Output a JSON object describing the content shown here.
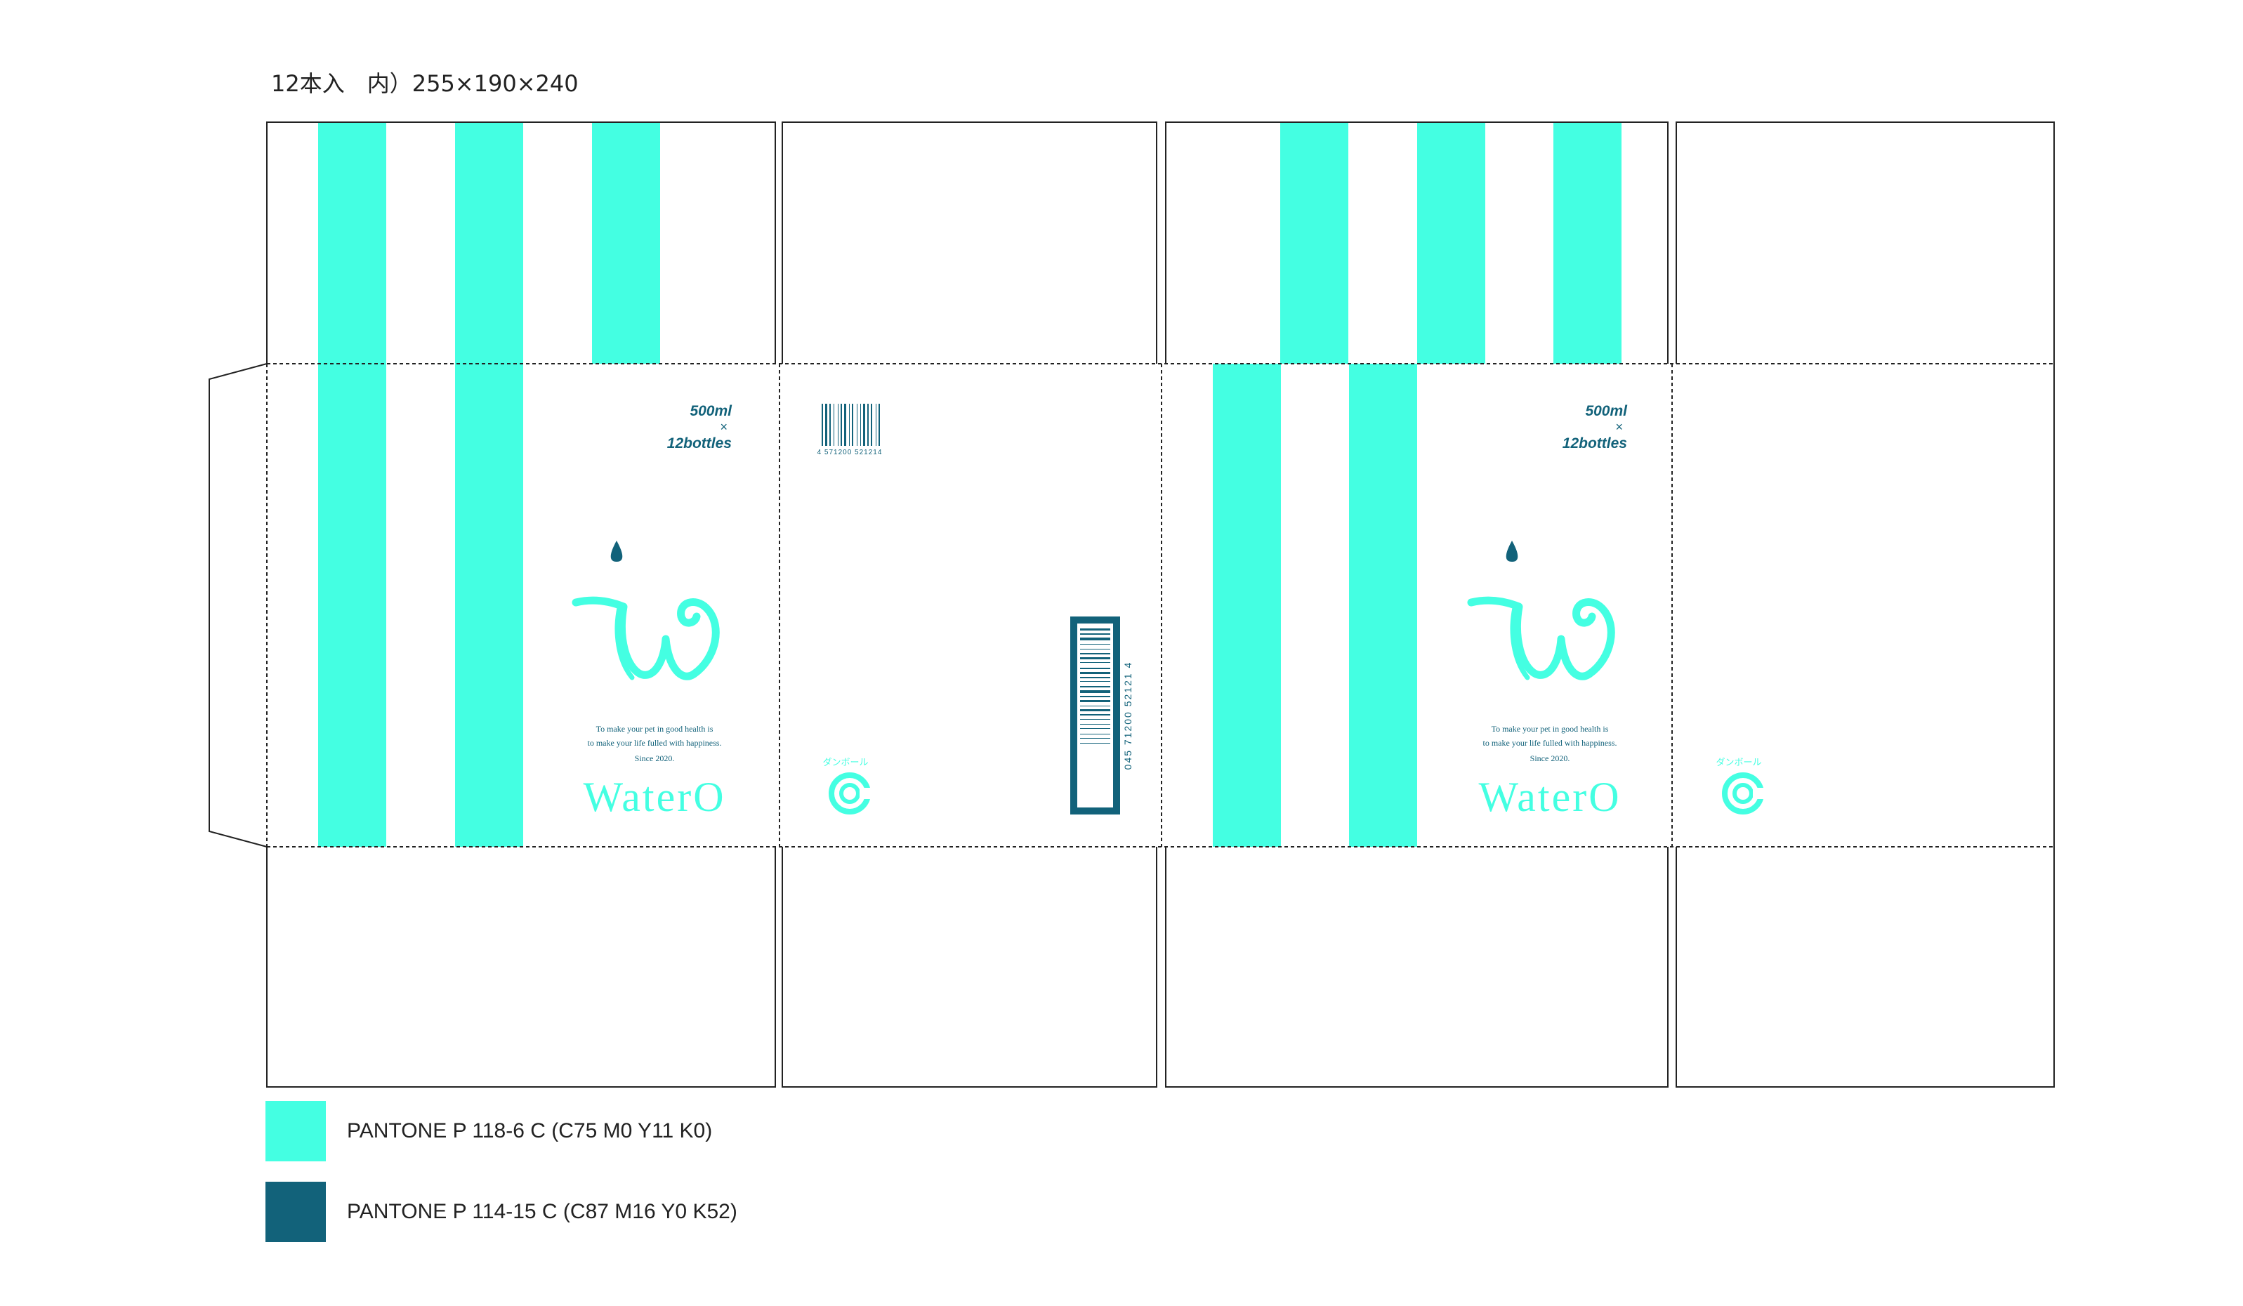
{
  "spec_title": "12本入　内）255×190×240",
  "colors": {
    "mint": "#44ffe2",
    "teal": "#12627a",
    "line": "#222222"
  },
  "front_panel": {
    "volume": "500ml",
    "times": "×",
    "count": "12bottles",
    "tagline_1": "To make your pet in good health is",
    "tagline_2": "to make your life fulled with happiness.",
    "since": "Since 2020.",
    "brand": "WaterO"
  },
  "back_panel": {
    "barcode_digits_small": "4 571200 521214",
    "barcode_digits_vertical": "045 71200 52121 4",
    "recycle_label": "ダンボール"
  },
  "legend": [
    {
      "label": "PANTONE P 118-6 C (C75 M0 Y11 K0)",
      "color": "#44ffe2"
    },
    {
      "label": "PANTONE P 114-15 C (C87 M16 Y0 K52)",
      "color": "#12627a"
    }
  ]
}
